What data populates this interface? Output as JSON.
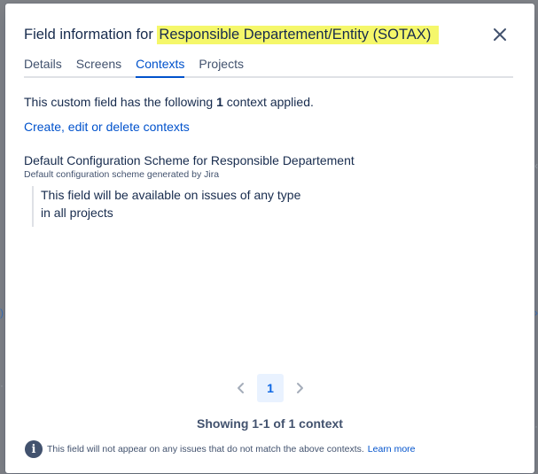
{
  "background": {
    "remnant_left": ")",
    "remnant_right": "›",
    "remnant_right2": "‹",
    "remnant_left2": "·",
    "remnant_right3": "·"
  },
  "modal": {
    "title_prefix": "Field information for",
    "title_field": "Responsible Departement/Entity (SOTAX)",
    "close_icon": "close-icon",
    "tabs": [
      {
        "label": "Details",
        "active": false
      },
      {
        "label": "Screens",
        "active": false
      },
      {
        "label": "Contexts",
        "active": true
      },
      {
        "label": "Projects",
        "active": false
      }
    ],
    "summary_pre": "This custom field has the following",
    "summary_count": "1",
    "summary_post": "context applied.",
    "link_label": "Create, edit or delete contexts",
    "scheme_name": "Default Configuration Scheme for Responsible Departement",
    "scheme_desc": "Default configuration scheme generated by Jira",
    "scheme_line1": "This field will be available on issues of any type",
    "scheme_line2": "in all projects",
    "pagination": {
      "prev_icon": "chevron-left-icon",
      "current_page": "1",
      "next_icon": "chevron-right-icon"
    },
    "showing_text": "Showing 1-1 of 1 context",
    "footer_note": "This field will not appear on any issues that do not match the above contexts.",
    "learn_more": "Learn more",
    "info_glyph": "i"
  },
  "colors": {
    "accent": "#0052cc",
    "highlight": "#f5f76a",
    "text": "#172b4d",
    "subtle": "#42526e"
  }
}
